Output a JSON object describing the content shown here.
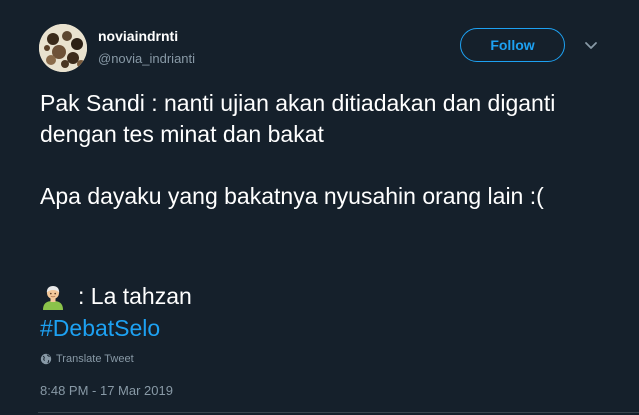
{
  "user": {
    "display_name": "noviaindrnti",
    "handle": "@novia_indrianti",
    "avatar_icon": "profile-photo"
  },
  "actions": {
    "follow_label": "Follow",
    "more_icon": "chevron-down-icon"
  },
  "tweet": {
    "text": "Pak Sandi : nanti ujian akan ditiadakan dan diganti dengan tes minat dan bakat\n\nApa dayaku yang bakatnya nyusahin orang lain :(",
    "emoji_icon": "old-man-emoji",
    "emoji_caption": ": La tahzan",
    "hashtag": "#DebatSelo",
    "translate_label": "Translate Tweet",
    "timestamp": "8:48 PM - 17 Mar 2019"
  },
  "colors": {
    "background": "#15202b",
    "text": "#ffffff",
    "secondary_text": "#8899a6",
    "accent": "#1da1f2",
    "divider": "#38444d"
  }
}
